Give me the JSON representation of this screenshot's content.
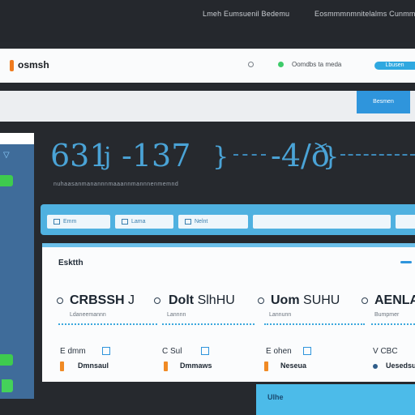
{
  "topbar": {
    "left_text": "Lmeh Eumsuenil Bedemu",
    "right_text": "Eosmmmnmnitelalms Cunmmmnt"
  },
  "header": {
    "logo": "osmsh",
    "indicator_a_color": "#ffffff",
    "indicator_b_color": "#3ecb6a",
    "nav_text": "Oomdbs ta meda",
    "cta": "Lbusen"
  },
  "band": {
    "button": "Besmen"
  },
  "stats": {
    "values": [
      "631",
      "-137",
      "-4/ð"
    ],
    "glyphs": [
      "j",
      "}",
      "}"
    ],
    "caption": "nuhaasanmanannnmaaannmannnenmemnd"
  },
  "filters": [
    {
      "label": "Emm"
    },
    {
      "label": "Lama"
    },
    {
      "label": "Nelnt"
    },
    {
      "label": ""
    }
  ],
  "panel": {
    "title": "Esktth",
    "columns": [
      {
        "name": "CRBSSH",
        "suffix": "J",
        "sub": "Ldaneemannn",
        "meta": "E dmm",
        "label": "Dmnsaul",
        "accent": "orange"
      },
      {
        "name": "Dolt",
        "suffix": "SlhHU",
        "sub": "Lannnn",
        "meta": "C Sul",
        "label": "Dmmaws",
        "accent": "orange"
      },
      {
        "name": "Uom",
        "suffix": "SUHU",
        "sub": "Lannunn",
        "meta": "E ohen",
        "label": "Neseua",
        "accent": "orange"
      },
      {
        "name": "AENLA",
        "suffix": "",
        "sub": "Bumpmer",
        "meta": "V CBC",
        "label": "Uesedsuc",
        "accent": "blue"
      }
    ]
  },
  "footer_card": {
    "label": "Ulhe"
  },
  "colors": {
    "accent_blue": "#4fb1e0",
    "accent_orange": "#f08a24",
    "success_green": "#3ecb4e"
  }
}
